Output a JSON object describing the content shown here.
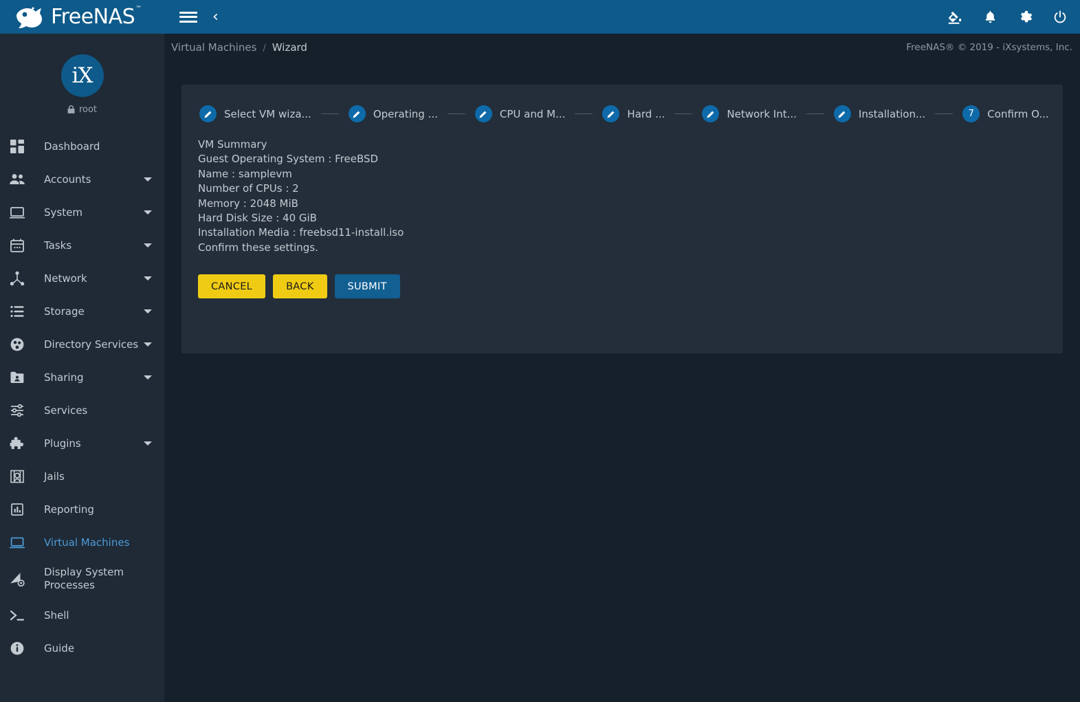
{
  "brand": {
    "name": "FreeNAS",
    "tm": "™",
    "logo_icon": "freenas-fish-logo"
  },
  "profile": {
    "avatar_text": "iX",
    "username": "root",
    "lock_icon": "lock-icon"
  },
  "sidebar": {
    "items": [
      {
        "label": "Dashboard",
        "icon": "dashboard-grid-icon",
        "expandable": false,
        "active": false,
        "key": "dashboard"
      },
      {
        "label": "Accounts",
        "icon": "people-icon",
        "expandable": true,
        "active": false,
        "key": "accounts"
      },
      {
        "label": "System",
        "icon": "monitor-icon",
        "expandable": true,
        "active": false,
        "key": "system"
      },
      {
        "label": "Tasks",
        "icon": "calendar-icon",
        "expandable": true,
        "active": false,
        "key": "tasks"
      },
      {
        "label": "Network",
        "icon": "network-nodes-icon",
        "expandable": true,
        "active": false,
        "key": "network"
      },
      {
        "label": "Storage",
        "icon": "storage-list-icon",
        "expandable": true,
        "active": false,
        "key": "storage"
      },
      {
        "label": "Directory Services",
        "icon": "directory-services-icon",
        "expandable": true,
        "active": false,
        "key": "directory-services"
      },
      {
        "label": "Sharing",
        "icon": "sharing-folder-icon",
        "expandable": true,
        "active": false,
        "key": "sharing"
      },
      {
        "label": "Services",
        "icon": "sliders-icon",
        "expandable": false,
        "active": false,
        "key": "services"
      },
      {
        "label": "Plugins",
        "icon": "puzzle-piece-icon",
        "expandable": true,
        "active": false,
        "key": "plugins"
      },
      {
        "label": "Jails",
        "icon": "jail-bars-icon",
        "expandable": false,
        "active": false,
        "key": "jails"
      },
      {
        "label": "Reporting",
        "icon": "bar-chart-icon",
        "expandable": false,
        "active": false,
        "key": "reporting"
      },
      {
        "label": "Virtual Machines",
        "icon": "laptop-icon",
        "expandable": false,
        "active": true,
        "key": "virtual-machines"
      },
      {
        "label": "Display System Processes",
        "icon": "processes-icon",
        "expandable": false,
        "active": false,
        "key": "display-system-processes"
      },
      {
        "label": "Shell",
        "icon": "terminal-prompt-icon",
        "expandable": false,
        "active": false,
        "key": "shell"
      },
      {
        "label": "Guide",
        "icon": "info-circle-icon",
        "expandable": false,
        "active": false,
        "key": "guide"
      }
    ]
  },
  "topbar": {
    "menu_icon": "hamburger-menu-icon",
    "back_icon": "chevron-left-icon",
    "back_glyph": "‹",
    "icons": [
      {
        "name": "theme-paint-bucket-icon"
      },
      {
        "name": "notifications-bell-icon"
      },
      {
        "name": "settings-gear-icon"
      },
      {
        "name": "power-icon"
      }
    ]
  },
  "breadcrumb": {
    "items": [
      "Virtual Machines",
      "Wizard"
    ],
    "separator": "/",
    "copyright": "FreeNAS® © 2019 - iXsystems, Inc."
  },
  "wizard": {
    "steps": [
      {
        "label": "Select VM wiza...",
        "marker": "edit-pencil-icon",
        "number": "1",
        "current": false
      },
      {
        "label": "Operating ...",
        "marker": "edit-pencil-icon",
        "number": "2",
        "current": false
      },
      {
        "label": "CPU and M...",
        "marker": "edit-pencil-icon",
        "number": "3",
        "current": false
      },
      {
        "label": "Hard ...",
        "marker": "edit-pencil-icon",
        "number": "4",
        "current": false
      },
      {
        "label": "Network Int...",
        "marker": "edit-pencil-icon",
        "number": "5",
        "current": false
      },
      {
        "label": "Installation...",
        "marker": "edit-pencil-icon",
        "number": "6",
        "current": false
      },
      {
        "label": "Confirm O...",
        "marker": "number",
        "number": "7",
        "current": true
      }
    ],
    "summary": [
      "VM Summary",
      "Guest Operating System : FreeBSD",
      "Name : samplevm",
      "Number of CPUs : 2",
      "Memory : 2048 MiB",
      "Hard Disk Size : 40 GiB",
      "Installation Media : freebsd11-install.iso",
      "Confirm these settings."
    ],
    "buttons": {
      "cancel": "CANCEL",
      "back": "BACK",
      "submit": "SUBMIT"
    }
  },
  "colors": {
    "brand_blue": "#0e5a8a",
    "accent_blue": "#0e6aa8",
    "active_nav": "#4d9ad6",
    "warn_yellow": "#f0cb14",
    "page_bg": "#16202a",
    "sidebar_bg": "#1f2a36",
    "card_bg": "#232e3a",
    "text": "#c3cad1"
  }
}
